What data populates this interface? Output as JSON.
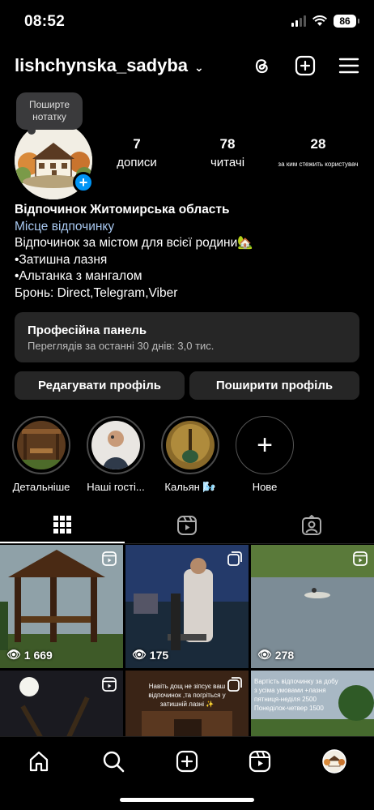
{
  "status_bar": {
    "time": "08:52",
    "battery": "86"
  },
  "profile": {
    "username": "lishchynska_sadyba",
    "note_bubble": "Поширте нотатку",
    "stats": [
      {
        "value": "7",
        "label": "дописи"
      },
      {
        "value": "78",
        "label": "читачі"
      },
      {
        "value": "28",
        "label": "за ким стежить користувач"
      }
    ],
    "bio": {
      "name": "Відпочинок Житомирська область",
      "category": "Місце відпочинку",
      "lines": [
        "Відпочинок за містом для всієї родини🏡",
        "•Затишна лазня",
        "•Альтанка з мангалом",
        "Бронь: Direct,Telegram,Viber"
      ]
    }
  },
  "professional_panel": {
    "title": "Професійна панель",
    "subtitle": "Переглядів за останні 30 днів: 3,0 тис."
  },
  "buttons": {
    "edit": "Редагувати профіль",
    "share": "Поширити профіль"
  },
  "highlights": [
    {
      "label": "Детальніше"
    },
    {
      "label": "Наші гості..."
    },
    {
      "label": "Кальян 🌬️"
    },
    {
      "label": "Нове"
    }
  ],
  "tabs": [
    "posts-grid",
    "reels",
    "tagged"
  ],
  "grid": [
    {
      "views": "1 669",
      "type": "reel"
    },
    {
      "views": "175",
      "type": "carousel"
    },
    {
      "views": "278",
      "type": "reel"
    },
    {
      "views": "",
      "type": "reel"
    },
    {
      "views": "",
      "type": "carousel",
      "caption": "Навіть дощ не зіпсує ваш відпочинок ,та погріться у затишній лазні ✨"
    },
    {
      "views": "",
      "type": "post",
      "caption": "Вартість відпочинку за добу з усіма умовами +лазня пятниця-неділя 2500 Понеділок-четвер 1500"
    }
  ],
  "colors": {
    "accent": "#0095f6",
    "link": "#a8c8f0",
    "panel": "#262626",
    "background": "#000000"
  }
}
